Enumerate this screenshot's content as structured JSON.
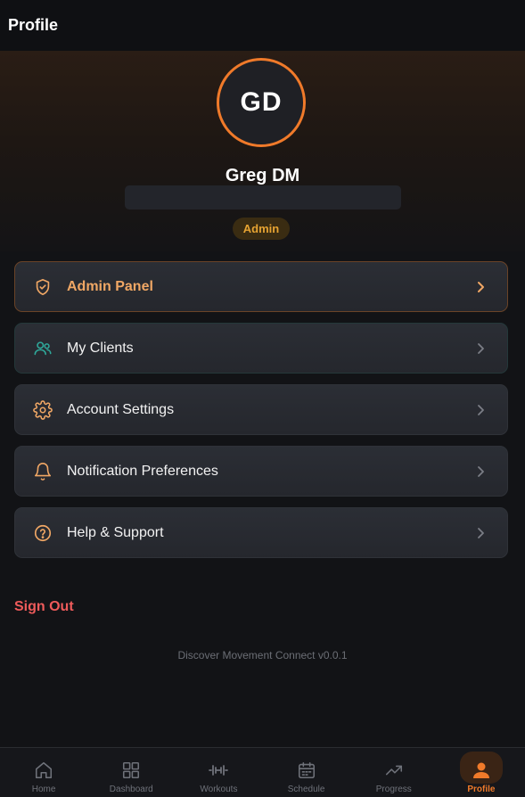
{
  "header": {
    "title": "Profile"
  },
  "profile": {
    "initials": "GD",
    "name": "Greg DM",
    "role": "Admin"
  },
  "menu": [
    {
      "label": "Admin Panel",
      "icon": "shield-check-icon"
    },
    {
      "label": "My Clients",
      "icon": "users-icon"
    },
    {
      "label": "Account Settings",
      "icon": "gear-icon"
    },
    {
      "label": "Notification Preferences",
      "icon": "bell-icon"
    },
    {
      "label": "Help & Support",
      "icon": "help-circle-icon"
    }
  ],
  "sign_out_label": "Sign Out",
  "version_text": "Discover Movement Connect v0.0.1",
  "nav": [
    {
      "label": "Home",
      "icon": "home-icon"
    },
    {
      "label": "Dashboard",
      "icon": "grid-icon"
    },
    {
      "label": "Workouts",
      "icon": "dumbbell-icon"
    },
    {
      "label": "Schedule",
      "icon": "calendar-icon"
    },
    {
      "label": "Progress",
      "icon": "trending-up-icon"
    },
    {
      "label": "Profile",
      "icon": "user-icon",
      "active": true
    }
  ],
  "colors": {
    "accent": "#f07a2a",
    "admin_badge": "#e6a332",
    "sign_out": "#ef5b5b",
    "clients_icon": "#2fa89a"
  }
}
